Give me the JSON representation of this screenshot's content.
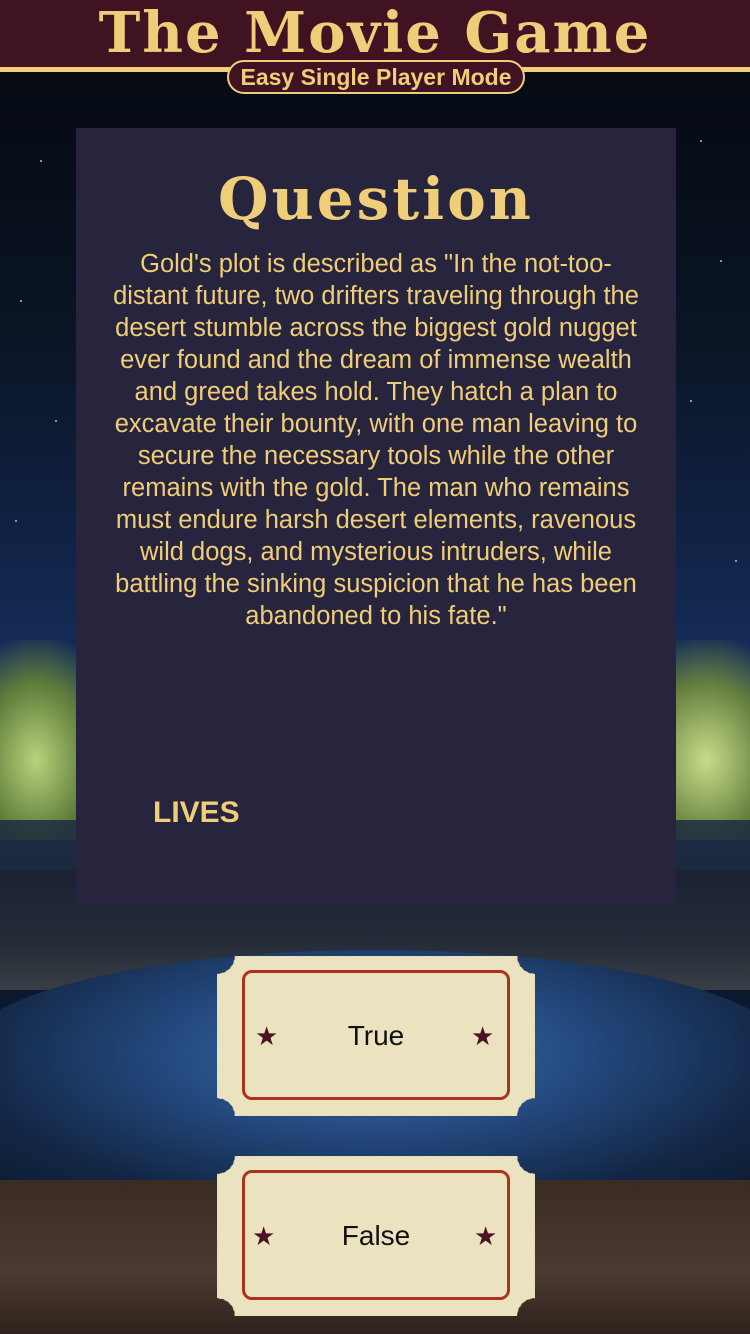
{
  "app": {
    "title": "The Movie Game",
    "mode": "Easy Single Player Mode"
  },
  "question_card": {
    "heading": "Question",
    "text": "Gold's plot is described as \"In the not-too-distant future, two drifters traveling through the desert stumble across the biggest gold nugget ever found and the dream of immense wealth and greed takes hold. They hatch a plan to excavate their bounty, with one man leaving to secure the necessary tools while the other remains with the gold. The man who remains must endure harsh desert elements, ravenous wild dogs, and mysterious intruders, while battling the sinking suspicion that he has been abandoned to his fate.\"",
    "lives_label": "LIVES"
  },
  "answers": [
    {
      "label": "True"
    },
    {
      "label": "False"
    }
  ],
  "colors": {
    "header_bg": "#401323",
    "accent_gold": "#f0cd78",
    "card_bg": "#27243d",
    "ticket_paper": "#ebe3bf",
    "ticket_border": "#a8331e",
    "star": "#4a1424"
  },
  "icons": {
    "ticket_star": "★"
  }
}
